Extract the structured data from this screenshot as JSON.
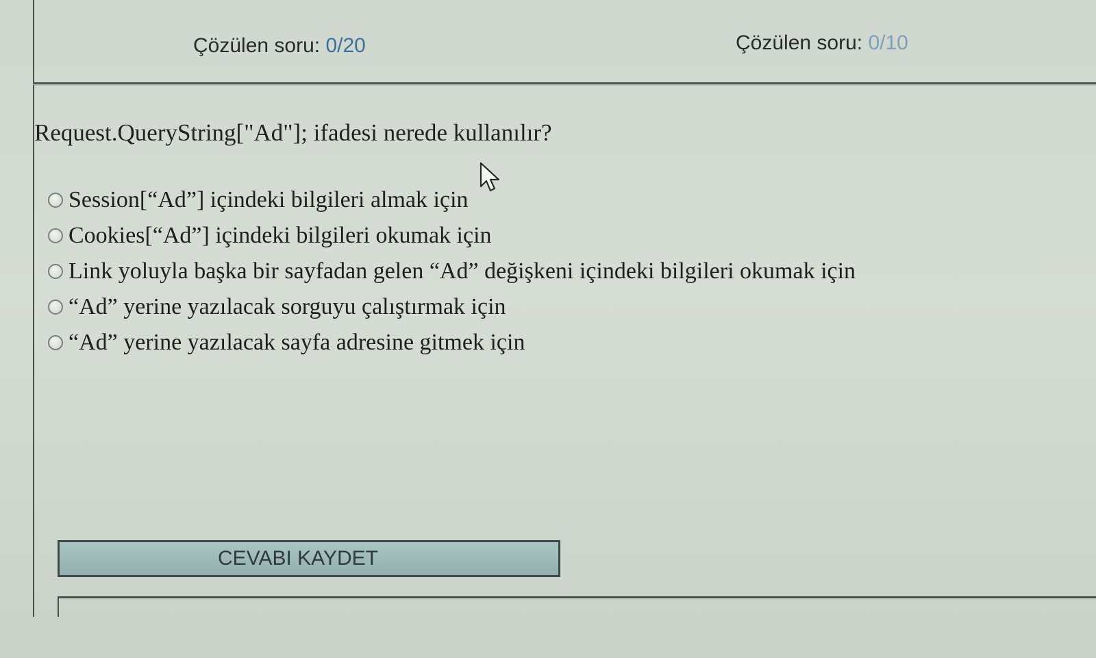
{
  "progress": {
    "left_label": "Çözülen soru: ",
    "left_count": "0/20",
    "right_label": "Çözülen soru: ",
    "right_count": "0/10"
  },
  "question": {
    "text": "Request.QueryString[\"Ad\"]; ifadesi nerede kullanılır?",
    "options": [
      {
        "label": "Session[“Ad”] içindeki bilgileri almak için"
      },
      {
        "label": "Cookies[“Ad”] içindeki bilgileri okumak için"
      },
      {
        "label": "Link yoluyla başka bir sayfadan gelen “Ad” değişkeni içindeki bilgileri okumak için"
      },
      {
        "label": "“Ad” yerine yazılacak sorguyu çalıştırmak için"
      },
      {
        "label": "“Ad” yerine yazılacak sayfa adresine gitmek için"
      }
    ]
  },
  "actions": {
    "save_label": "CEVABI KAYDET"
  },
  "icons": {
    "cursor": "mouse-pointer-icon",
    "radio": "radio-button-icon"
  },
  "colors": {
    "count_primary": "#3f6f9a",
    "count_secondary": "#7f9fb8",
    "button_bg": "#9bb8b7"
  }
}
